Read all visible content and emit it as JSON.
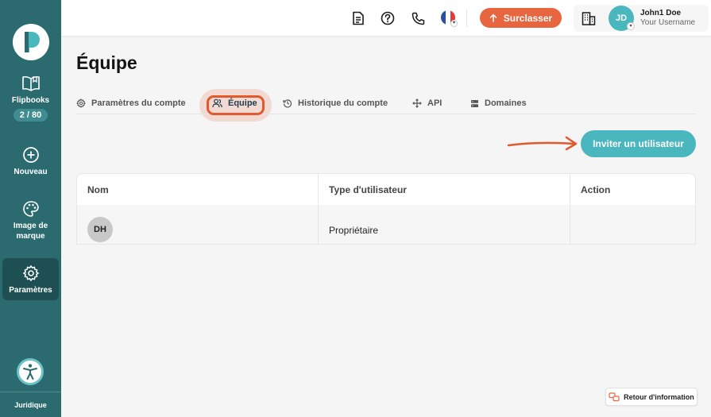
{
  "sidebar": {
    "items": [
      {
        "label": "Flipbooks",
        "counter": "2 / 80"
      },
      {
        "label": "Nouveau"
      },
      {
        "label": "Image de marque"
      },
      {
        "label": "Paramètres"
      }
    ],
    "footer_label": "Juridique"
  },
  "header": {
    "upgrade_label": "Surclasser",
    "user": {
      "initials": "JD",
      "name": "John1 Doe",
      "subtitle": "Your Username"
    }
  },
  "page": {
    "title": "Équipe",
    "tabs": [
      {
        "label": "Paramètres du compte"
      },
      {
        "label": "Équipe"
      },
      {
        "label": "Historique du compte"
      },
      {
        "label": "API"
      },
      {
        "label": "Domaines"
      }
    ],
    "invite_label": "Inviter un utilisateur"
  },
  "table": {
    "headers": [
      "Nom",
      "Type d'utilisateur",
      "Action"
    ],
    "rows": [
      {
        "initials": "DH",
        "type": "Propriétaire",
        "action": ""
      }
    ]
  },
  "feedback_label": "Retour d'information",
  "colors": {
    "sidebar": "#2b6b70",
    "accent": "#4ab6be",
    "upgrade": "#e8663f",
    "highlight": "#e0592f"
  }
}
